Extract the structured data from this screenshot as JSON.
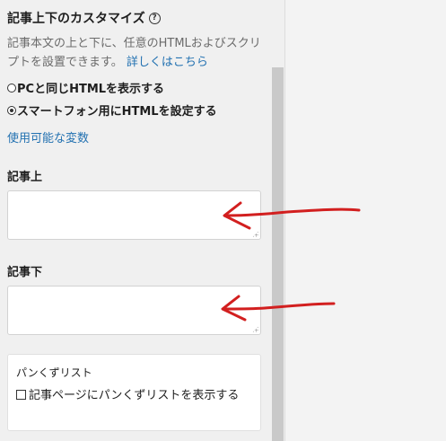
{
  "section": {
    "title": "記事上下のカスタマイズ",
    "help_icon": "question-circle-icon",
    "description": "記事本文の上と下に、任意のHTMLおよびスクリプトを設置できます。",
    "details_link": "詳しくはこちら"
  },
  "radio_options": [
    {
      "label": "PCと同じHTMLを表示する",
      "checked": false
    },
    {
      "label": "スマートフォン用にHTMLを設定する",
      "checked": true
    }
  ],
  "variables_link": "使用可能な変数",
  "fields": {
    "above": {
      "label": "記事上",
      "value": ""
    },
    "below": {
      "label": "記事下",
      "value": ""
    }
  },
  "breadcrumb_card": {
    "title": "パンくずリスト",
    "checkbox_label": "記事ページにパンくずリストを表示する",
    "checked": false
  },
  "colors": {
    "link": "#2271b1",
    "annotation_arrow": "#d21f1f"
  }
}
